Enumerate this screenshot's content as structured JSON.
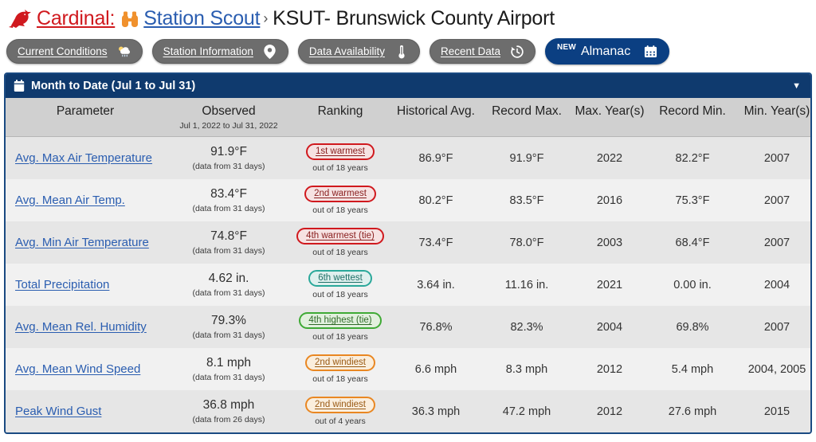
{
  "breadcrumb": {
    "bird_icon": "cardinal-bird-icon",
    "app_name": "Cardinal:",
    "binoculars_icon": "binoculars-icon",
    "section": "Station Scout",
    "separator": "›",
    "current": "KSUT- Brunswick County Airport"
  },
  "nav": {
    "buttons": [
      {
        "label": "Current Conditions",
        "icon": "cloud-sun-rain-icon",
        "active": false
      },
      {
        "label": "Station Information",
        "icon": "map-pin-icon",
        "active": false
      },
      {
        "label": "Data Availability",
        "icon": "thermometer-icon",
        "active": false
      },
      {
        "label": "Recent Data",
        "icon": "history-clock-icon",
        "active": false
      },
      {
        "label": "Almanac",
        "icon": "calendar-icon",
        "active": true,
        "badge": "NEW"
      }
    ]
  },
  "panel": {
    "icon": "calendar-icon",
    "title": "Month to Date (Jul 1 to Jul 31)",
    "caret": "▼"
  },
  "table": {
    "headers": [
      {
        "label": "Parameter",
        "sub": ""
      },
      {
        "label": "Observed",
        "sub": "Jul 1, 2022 to Jul 31, 2022"
      },
      {
        "label": "Ranking",
        "sub": ""
      },
      {
        "label": "Historical Avg.",
        "sub": ""
      },
      {
        "label": "Record Max.",
        "sub": ""
      },
      {
        "label": "Max. Year(s)",
        "sub": ""
      },
      {
        "label": "Record Min.",
        "sub": ""
      },
      {
        "label": "Min. Year(s)",
        "sub": ""
      }
    ],
    "rows": [
      {
        "parameter": "Avg. Max Air Temperature",
        "observed": "91.9°F",
        "observed_sub": "(data from 31 days)",
        "rank": "1st warmest",
        "rank_sub": "out of 18 years",
        "rank_color": "#d0191e",
        "rank_bg": "#f6e2e2",
        "rank_text": "#8a2020",
        "historical_avg": "86.9°F",
        "record_max": "91.9°F",
        "max_years": "2022",
        "record_min": "82.2°F",
        "min_years": "2007"
      },
      {
        "parameter": "Avg. Mean Air Temp.",
        "observed": "83.4°F",
        "observed_sub": "(data from 31 days)",
        "rank": "2nd warmest",
        "rank_sub": "out of 18 years",
        "rank_color": "#d0191e",
        "rank_bg": "#f6e2e2",
        "rank_text": "#8a2020",
        "historical_avg": "80.2°F",
        "record_max": "83.5°F",
        "max_years": "2016",
        "record_min": "75.3°F",
        "min_years": "2007"
      },
      {
        "parameter": "Avg. Min Air Temperature",
        "observed": "74.8°F",
        "observed_sub": "(data from 31 days)",
        "rank": "4th warmest (tie)",
        "rank_sub": "out of 18 years",
        "rank_color": "#d0191e",
        "rank_bg": "#f6e2e2",
        "rank_text": "#8a2020",
        "historical_avg": "73.4°F",
        "record_max": "78.0°F",
        "max_years": "2003",
        "record_min": "68.4°F",
        "min_years": "2007"
      },
      {
        "parameter": "Total Precipitation",
        "observed": "4.62 in.",
        "observed_sub": "(data from 31 days)",
        "rank": "6th wettest",
        "rank_sub": "out of 18 years",
        "rank_color": "#2aa89a",
        "rank_bg": "#dff0ee",
        "rank_text": "#1d6f66",
        "historical_avg": "3.64 in.",
        "record_max": "11.16 in.",
        "max_years": "2021",
        "record_min": "0.00 in.",
        "min_years": "2004"
      },
      {
        "parameter": "Avg. Mean Rel. Humidity",
        "observed": "79.3%",
        "observed_sub": "(data from 31 days)",
        "rank": "4th highest (tie)",
        "rank_sub": "out of 18 years",
        "rank_color": "#3faa35",
        "rank_bg": "#e2f0de",
        "rank_text": "#2f6b28",
        "historical_avg": "76.8%",
        "record_max": "82.3%",
        "max_years": "2004",
        "record_min": "69.8%",
        "min_years": "2007"
      },
      {
        "parameter": "Avg. Mean Wind Speed",
        "observed": "8.1 mph",
        "observed_sub": "(data from 31 days)",
        "rank": "2nd windiest",
        "rank_sub": "out of 18 years",
        "rank_color": "#e98722",
        "rank_bg": "#faeedd",
        "rank_text": "#9a5a14",
        "historical_avg": "6.6 mph",
        "record_max": "8.3 mph",
        "max_years": "2012",
        "record_min": "5.4 mph",
        "min_years": "2004, 2005"
      },
      {
        "parameter": "Peak Wind Gust",
        "observed": "36.8 mph",
        "observed_sub": "(data from 26 days)",
        "rank": "2nd windiest",
        "rank_sub": "out of 4 years",
        "rank_color": "#e98722",
        "rank_bg": "#faeedd",
        "rank_text": "#9a5a14",
        "historical_avg": "36.3 mph",
        "record_max": "47.2 mph",
        "max_years": "2012",
        "record_min": "27.6 mph",
        "min_years": "2015"
      }
    ]
  },
  "colors": {
    "brand_red": "#d0191e",
    "brand_blue": "#2a5db0",
    "panel_blue": "#0f3a6e",
    "pill_gray": "#6d6d6d",
    "accent_orange": "#f0912d"
  }
}
